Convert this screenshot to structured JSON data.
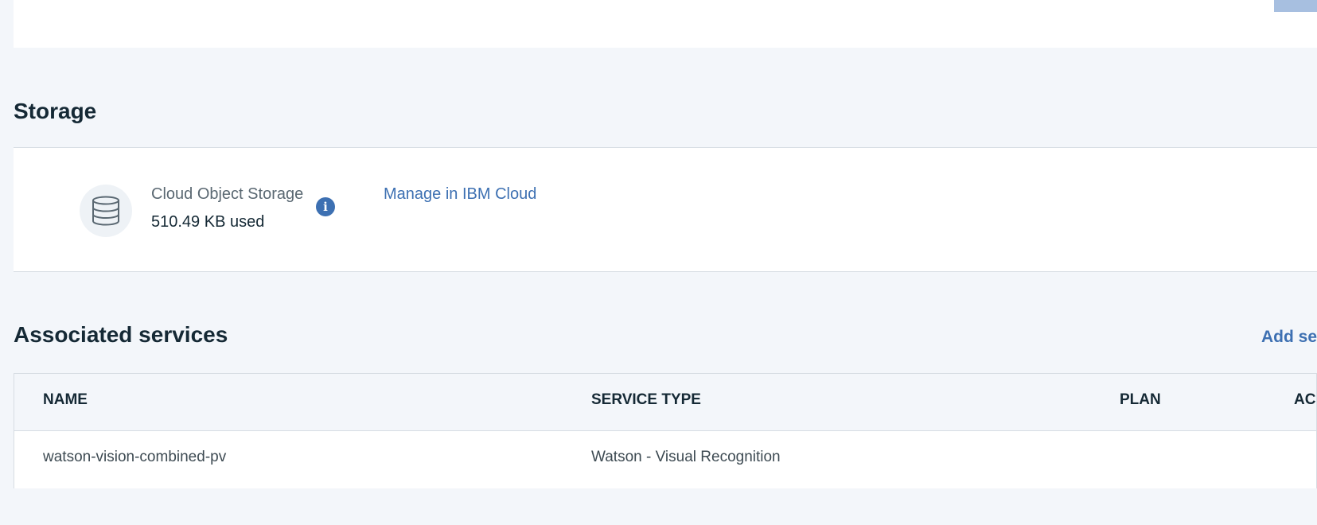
{
  "storage": {
    "title": "Storage",
    "name": "Cloud Object Storage",
    "usage": "510.49 KB used",
    "info_icon": "i",
    "manage_link": "Manage in IBM Cloud"
  },
  "services": {
    "title": "Associated services",
    "add_link": "Add ser",
    "columns": {
      "name": "NAME",
      "service_type": "SERVICE TYPE",
      "plan": "PLAN",
      "actions": "AC"
    },
    "rows": [
      {
        "name": "watson-vision-combined-pv",
        "service_type": "Watson - Visual Recognition",
        "plan": ""
      }
    ]
  },
  "colors": {
    "page_background": "#f3f6fa",
    "card_background": "#ffffff",
    "link": "#3d70b2",
    "text": "#152935",
    "border": "#d7dde3"
  },
  "icons": {
    "storage": "database-icon",
    "info": "info-icon"
  }
}
